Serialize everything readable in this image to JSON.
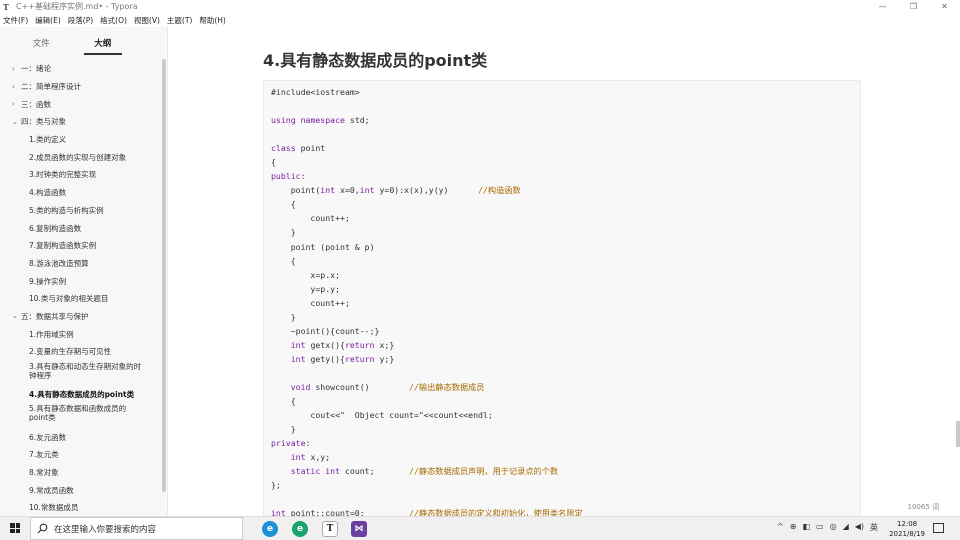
{
  "window": {
    "title": "C++基础程序实例.md• - Typora",
    "controls": {
      "minimize": "—",
      "maximize": "❐",
      "close": "✕"
    }
  },
  "menu": [
    "文件(F)",
    "编辑(E)",
    "段落(P)",
    "格式(O)",
    "视图(V)",
    "主题(T)",
    "帮助(H)"
  ],
  "sidebar": {
    "tabs": [
      {
        "label": "文件",
        "active": false
      },
      {
        "label": "大纲",
        "active": true
      }
    ],
    "outline": [
      {
        "label": "一：绪论",
        "level": 1,
        "chevron": "›"
      },
      {
        "label": "二：简单程序设计",
        "level": 1,
        "chevron": "›"
      },
      {
        "label": "三：函数",
        "level": 1,
        "chevron": "›"
      },
      {
        "label": "四：类与对象",
        "level": 1,
        "chevron": "⌄"
      },
      {
        "label": "1.类的定义",
        "level": 2
      },
      {
        "label": "2.成员函数的实现与创建对象",
        "level": 2
      },
      {
        "label": "3.时钟类的完整实现",
        "level": 2
      },
      {
        "label": "4.构造函数",
        "level": 2
      },
      {
        "label": "5.类的构造与析构实例",
        "level": 2
      },
      {
        "label": "6.复制构造函数",
        "level": 2
      },
      {
        "label": "7.复制构造函数实例",
        "level": 2
      },
      {
        "label": "8.游泳池改造预算",
        "level": 2
      },
      {
        "label": "9.操作实例",
        "level": 2
      },
      {
        "label": "10.类与对象的相关题目",
        "level": 2
      },
      {
        "label": "五：数据共享与保护",
        "level": 1,
        "chevron": "⌄"
      },
      {
        "label": "1.作用域实例",
        "level": 2
      },
      {
        "label": "2.变量的生存期与可见性",
        "level": 2
      },
      {
        "label": "3.具有静态和动态生存期对象的时钟程序",
        "level": 2,
        "two": true
      },
      {
        "label": "4.具有静态数据成员的point类",
        "level": 2,
        "active": true
      },
      {
        "label": "5.具有静态数据和函数成员的point类",
        "level": 2,
        "two": true
      },
      {
        "label": "6.友元函数",
        "level": 2
      },
      {
        "label": "7.友元类",
        "level": 2
      },
      {
        "label": "8.常对象",
        "level": 2
      },
      {
        "label": "9.常成员函数",
        "level": 2
      },
      {
        "label": "10.常数据成员",
        "level": 2
      }
    ],
    "bottom_icons": {
      "back": "‹",
      "source": "</>"
    }
  },
  "document": {
    "heading": "4.具有静态数据成员的point类",
    "code_lines": [
      "#include<iostream>",
      "",
      "using namespace std;",
      "",
      "class point",
      "{",
      "public:",
      "    point(int x=0,int y=0):x(x),y(y)      //构造函数",
      "    {",
      "        count++;",
      "    }",
      "    point (point & p)",
      "    {",
      "        x=p.x;",
      "        y=p.y;",
      "        count++;",
      "    }",
      "    ~point(){count--;}",
      "    int getx(){return x;}",
      "    int gety(){return y;}",
      "",
      "    void showcount()        //输出静态数据成员",
      "    {",
      "        cout<<\"  Object count=\"<<count<<endl;",
      "    }",
      "private:",
      "    int x,y;",
      "    static int count;       //静态数据成员声明，用于记录点的个数",
      "};",
      "",
      "int point::count=0;         //静态数据成员的定义和初始化，使用类名限定"
    ],
    "word_count": "10065 词"
  },
  "taskbar": {
    "search_placeholder": "在这里输入你要搜索的内容",
    "apps": [
      {
        "name": "edge-legacy-icon",
        "glyph": "e",
        "color": "#1e90d6"
      },
      {
        "name": "edge-icon",
        "glyph": "e",
        "color": "#1aa36b"
      },
      {
        "name": "typora-icon",
        "glyph": "T",
        "color": "#ffffff"
      },
      {
        "name": "visual-studio-icon",
        "glyph": "⋈",
        "color": "#6b3fa0"
      }
    ],
    "tray": [
      "^",
      "⊕",
      "◧",
      "▭",
      "◎",
      "◢",
      "◀)",
      "英"
    ],
    "time": "12:08",
    "date": "2021/8/19"
  }
}
